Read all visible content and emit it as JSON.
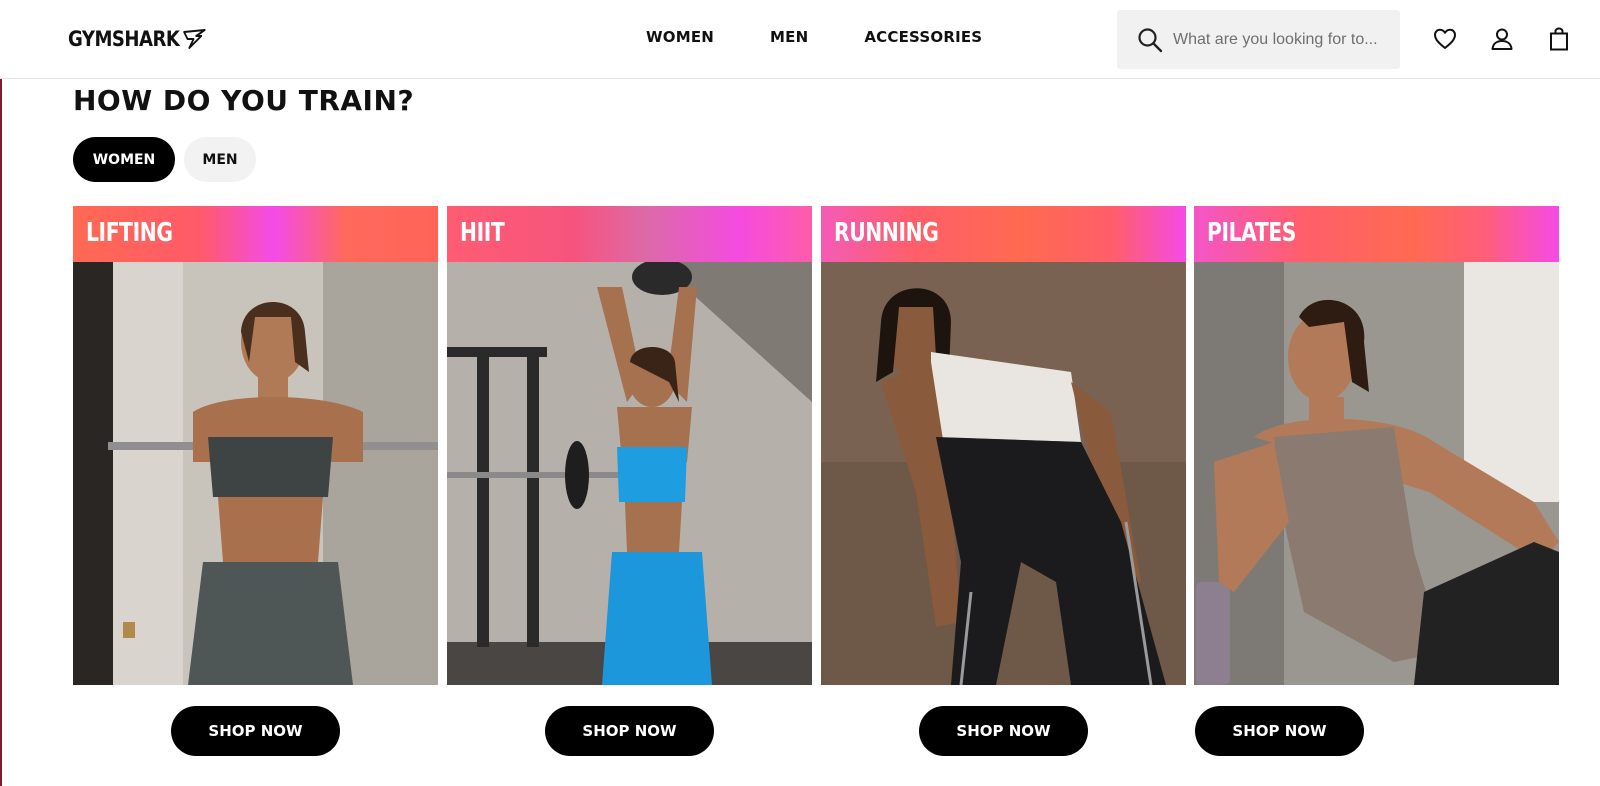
{
  "header": {
    "logo_text": "GYMSHARK",
    "nav": [
      "WOMEN",
      "MEN",
      "ACCESSORIES"
    ],
    "search_placeholder": "What are you looking for to...",
    "icons": [
      "search-icon",
      "heart-icon",
      "account-icon",
      "bag-icon"
    ]
  },
  "section": {
    "title": "HOW DO YOU TRAIN?",
    "toggle": {
      "active": "WOMEN",
      "inactive": "MEN"
    }
  },
  "cards": [
    {
      "label": "LIFTING",
      "button": "SHOP NOW"
    },
    {
      "label": "HIIT",
      "button": "SHOP NOW"
    },
    {
      "label": "RUNNING",
      "button": "SHOP NOW"
    },
    {
      "label": "PILATES",
      "button": "SHOP NOW"
    }
  ],
  "colors": {
    "banner_coral": "#ff5f5f",
    "banner_pink": "#f74be6",
    "button_bg": "#000000",
    "search_bg": "#f1f1f1"
  }
}
